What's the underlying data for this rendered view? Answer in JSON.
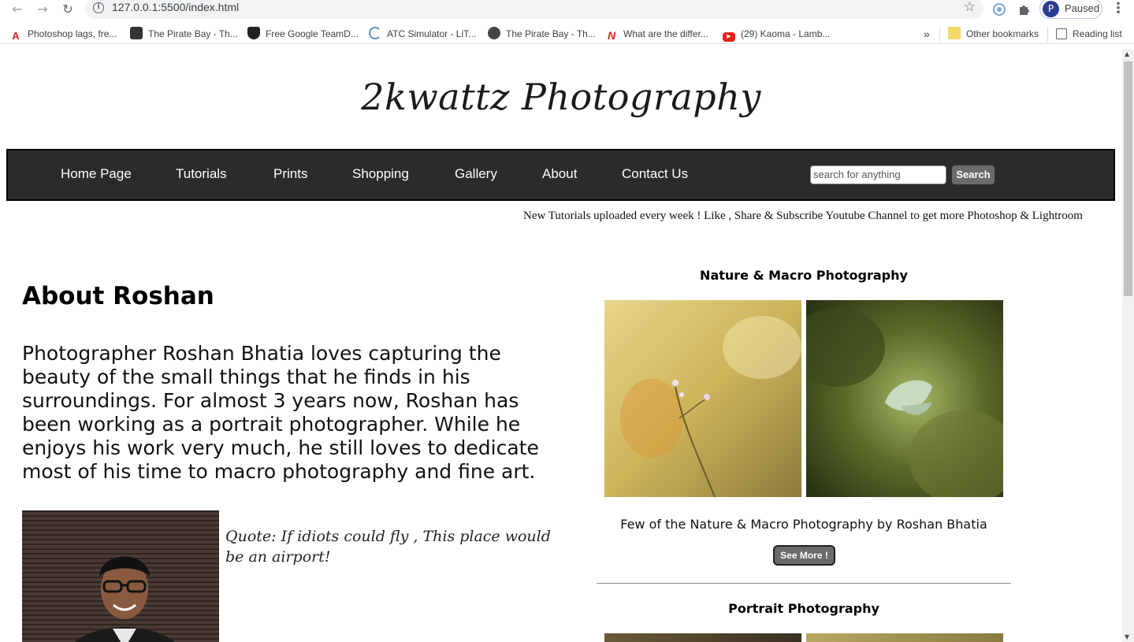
{
  "browser": {
    "url": "127.0.0.1:5500/index.html",
    "profile_initial": "P",
    "profile_status": "Paused",
    "bookmarks": [
      {
        "label": "Photoshop lags, fre...",
        "icon": "adobe-icon"
      },
      {
        "label": "The Pirate Bay - Th...",
        "icon": "pirate-ship-icon"
      },
      {
        "label": "Free Google TeamD...",
        "icon": "shield-icon"
      },
      {
        "label": "ATC Simulator - LiT...",
        "icon": "atc-icon"
      },
      {
        "label": "The Pirate Bay - Th...",
        "icon": "circle-icon"
      },
      {
        "label": "What are the differ...",
        "icon": "n-logo-icon"
      },
      {
        "label": "(29) Kaoma - Lamb...",
        "icon": "youtube-icon"
      }
    ],
    "overflow_label": "»",
    "other_bookmarks": "Other bookmarks",
    "reading_list": "Reading list"
  },
  "site": {
    "title": "2kwattz Photography",
    "nav": [
      "Home Page",
      "Tutorials",
      "Prints",
      "Shopping",
      "Gallery",
      "About",
      "Contact Us"
    ],
    "search_placeholder": "search for anything",
    "search_button": "Search",
    "marquee": "New Tutorials uploaded every week ! Like , Share & Subscribe Youtube Channel to get more Photoshop & Lightroom"
  },
  "about": {
    "heading": "About Roshan",
    "text": "Photographer Roshan Bhatia loves capturing the beauty of the small things that he finds in his surroundings. For almost 3 years now, Roshan has been working as a portrait photographer. While he enjoys his work very much, he still loves to dedicate most of his time to macro photography and fine art.",
    "quote": "Quote: If idiots could fly , This place would be an airport!"
  },
  "sections": {
    "nature": {
      "title": "Nature & Macro Photography",
      "caption": "Few of the Nature & Macro Photography by Roshan Bhatia",
      "button": "See More !"
    },
    "portrait": {
      "title": "Portrait Photography"
    }
  },
  "colors": {
    "navbar_bg": "#2b2b2b",
    "button_bg": "#6b6b6b"
  }
}
